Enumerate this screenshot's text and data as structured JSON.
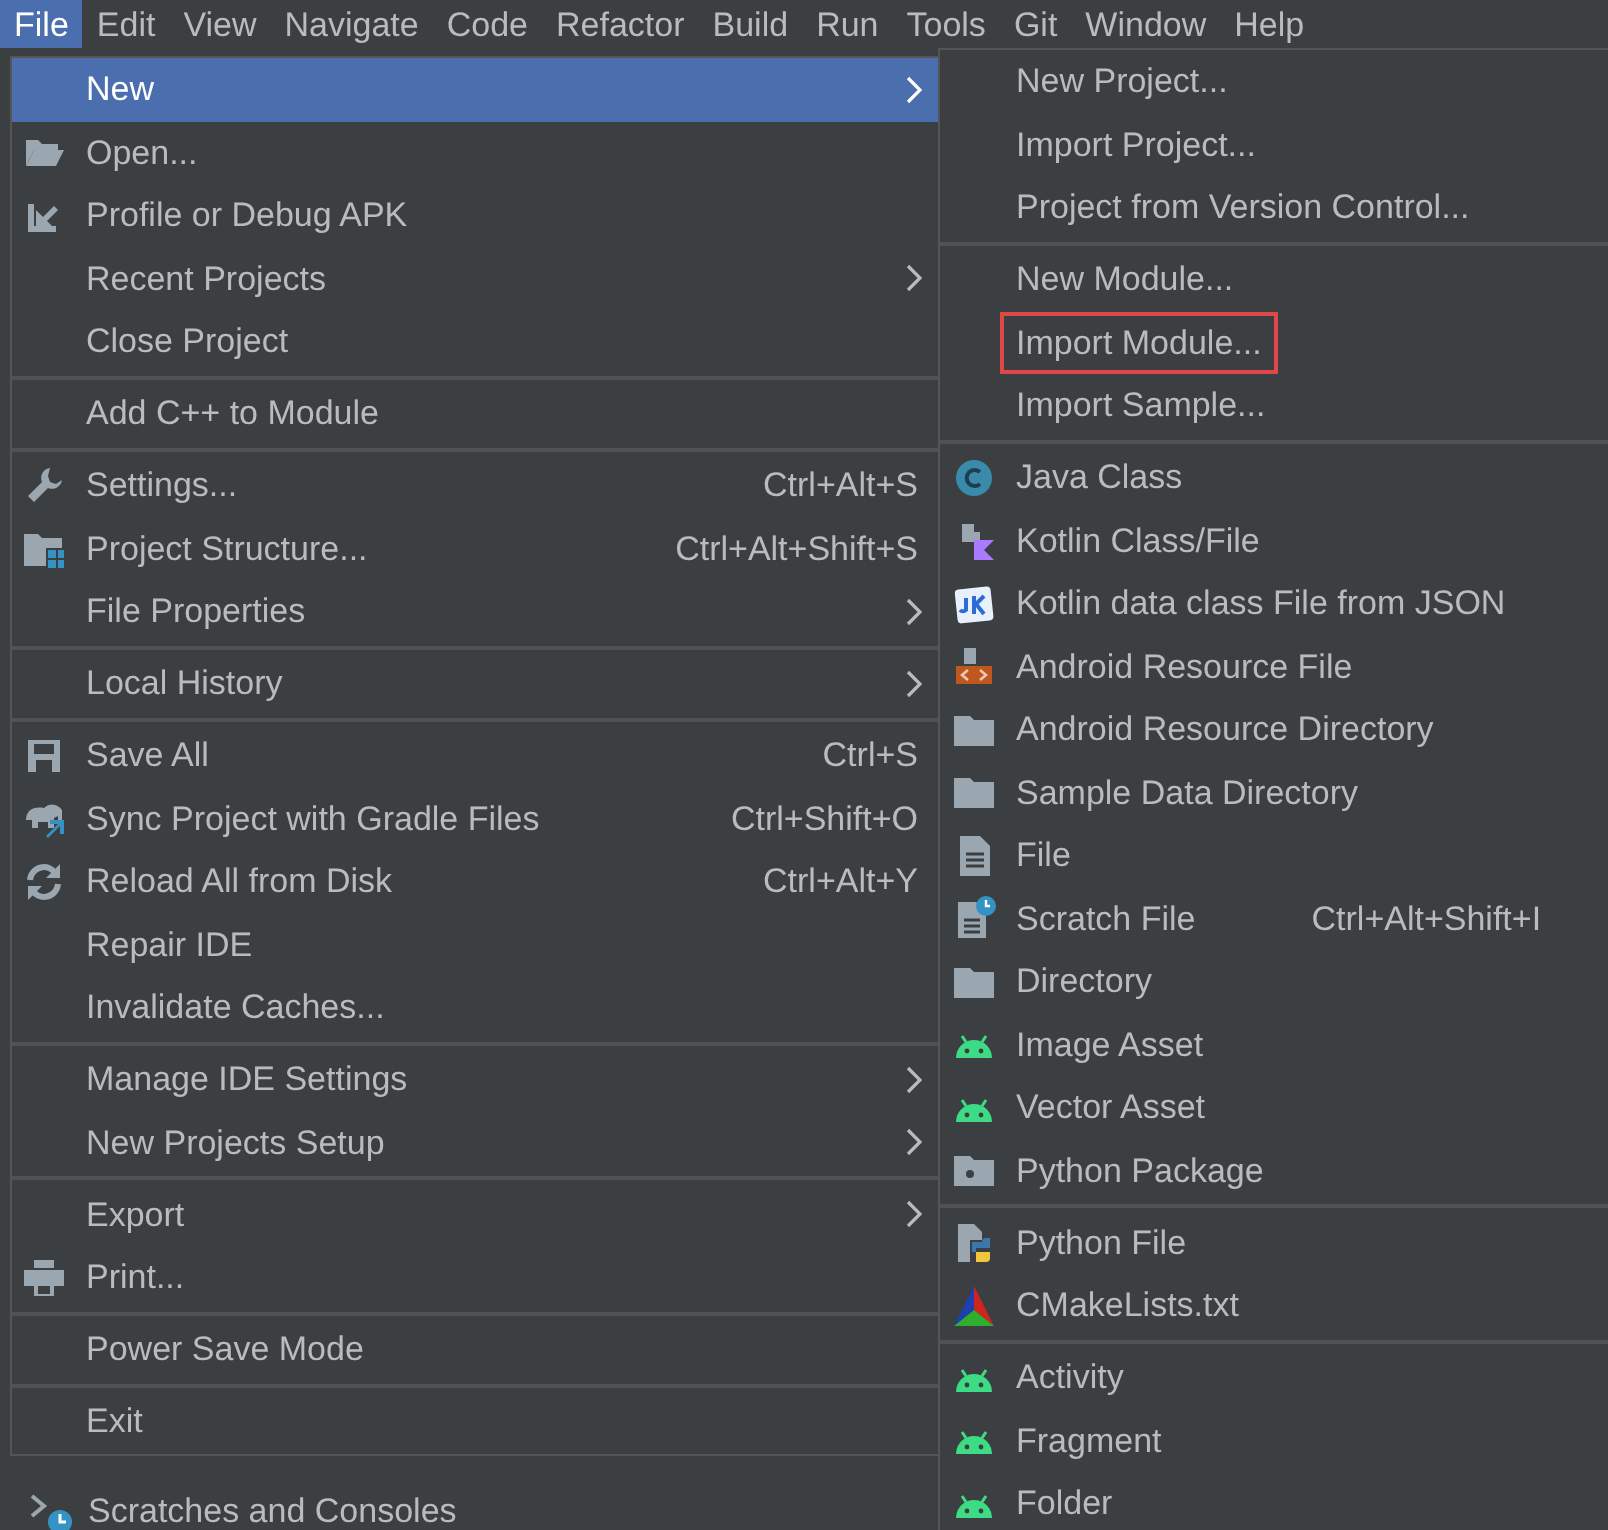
{
  "menu_bar": [
    {
      "label": "File",
      "selected": true
    },
    {
      "label": "Edit",
      "selected": false
    },
    {
      "label": "View",
      "selected": false
    },
    {
      "label": "Navigate",
      "selected": false
    },
    {
      "label": "Code",
      "selected": false
    },
    {
      "label": "Refactor",
      "selected": false
    },
    {
      "label": "Build",
      "selected": false
    },
    {
      "label": "Run",
      "selected": false
    },
    {
      "label": "Tools",
      "selected": false
    },
    {
      "label": "Git",
      "selected": false
    },
    {
      "label": "Window",
      "selected": false
    },
    {
      "label": "Help",
      "selected": false
    }
  ],
  "file_menu": [
    {
      "kind": "plain",
      "label": "New",
      "selected": true,
      "submenu": true
    },
    {
      "kind": "open",
      "label": "Open...",
      "selected": false,
      "submenu": false
    },
    {
      "kind": "apk",
      "label": "Profile or Debug APK",
      "selected": false,
      "submenu": false
    },
    {
      "kind": "plain",
      "label": "Recent Projects",
      "selected": false,
      "submenu": true
    },
    {
      "kind": "plain",
      "label": "Close Project",
      "selected": false,
      "submenu": false
    },
    {
      "kind": "separator"
    },
    {
      "kind": "plain",
      "label": "Add C++ to Module",
      "selected": false,
      "submenu": false
    },
    {
      "kind": "separator"
    },
    {
      "kind": "settings",
      "label": "Settings...",
      "shortcut": "Ctrl+Alt+S",
      "selected": false,
      "submenu": false
    },
    {
      "kind": "structure",
      "label": "Project Structure...",
      "shortcut": "Ctrl+Alt+Shift+S",
      "selected": false,
      "submenu": false
    },
    {
      "kind": "plain",
      "label": "File Properties",
      "selected": false,
      "submenu": true
    },
    {
      "kind": "separator"
    },
    {
      "kind": "plain",
      "label": "Local History",
      "selected": false,
      "submenu": true
    },
    {
      "kind": "separator"
    },
    {
      "kind": "save",
      "label": "Save All",
      "shortcut": "Ctrl+S",
      "selected": false,
      "submenu": false
    },
    {
      "kind": "sync",
      "label": "Sync Project with Gradle Files",
      "shortcut": "Ctrl+Shift+O",
      "selected": false,
      "submenu": false
    },
    {
      "kind": "reload",
      "label": "Reload All from Disk",
      "shortcut": "Ctrl+Alt+Y",
      "selected": false,
      "submenu": false
    },
    {
      "kind": "plain",
      "label": "Repair IDE",
      "selected": false,
      "submenu": false
    },
    {
      "kind": "plain",
      "label": "Invalidate Caches...",
      "selected": false,
      "submenu": false
    },
    {
      "kind": "separator"
    },
    {
      "kind": "plain",
      "label": "Manage IDE Settings",
      "selected": false,
      "submenu": true
    },
    {
      "kind": "plain",
      "label": "New Projects Setup",
      "selected": false,
      "submenu": true
    },
    {
      "kind": "separator"
    },
    {
      "kind": "plain",
      "label": "Export",
      "selected": false,
      "submenu": true
    },
    {
      "kind": "print",
      "label": "Print...",
      "selected": false,
      "submenu": false
    },
    {
      "kind": "separator"
    },
    {
      "kind": "plain",
      "label": "Power Save Mode",
      "selected": false,
      "submenu": false
    },
    {
      "kind": "separator"
    },
    {
      "kind": "plain",
      "label": "Exit",
      "selected": false,
      "submenu": false
    }
  ],
  "new_submenu": [
    {
      "kind": "plain",
      "label": "New Project...",
      "highlighted": false
    },
    {
      "kind": "plain",
      "label": "Import Project...",
      "highlighted": false
    },
    {
      "kind": "plain",
      "label": "Project from Version Control...",
      "highlighted": false
    },
    {
      "kind": "separator"
    },
    {
      "kind": "plain",
      "label": "New Module...",
      "highlighted": false
    },
    {
      "kind": "plain",
      "label": "Import Module...",
      "highlighted": true
    },
    {
      "kind": "plain",
      "label": "Import Sample...",
      "highlighted": false
    },
    {
      "kind": "separator"
    },
    {
      "kind": "java",
      "label": "Java Class",
      "highlighted": false
    },
    {
      "kind": "kotlin",
      "label": "Kotlin Class/File",
      "highlighted": false
    },
    {
      "kind": "json",
      "label": "Kotlin data class File from JSON",
      "highlighted": false
    },
    {
      "kind": "resource",
      "label": "Android Resource File",
      "highlighted": false
    },
    {
      "kind": "directory",
      "label": "Android Resource Directory",
      "highlighted": false
    },
    {
      "kind": "directory",
      "label": "Sample Data Directory",
      "highlighted": false
    },
    {
      "kind": "file",
      "label": "File",
      "highlighted": false
    },
    {
      "kind": "scratch",
      "label": "Scratch File",
      "shortcut": "Ctrl+Alt+Shift+I",
      "highlighted": false
    },
    {
      "kind": "directory",
      "label": "Directory",
      "highlighted": false
    },
    {
      "kind": "android",
      "label": "Image Asset",
      "highlighted": false
    },
    {
      "kind": "android",
      "label": "Vector Asset",
      "highlighted": false
    },
    {
      "kind": "package",
      "label": "Python Package",
      "highlighted": false
    },
    {
      "kind": "separator"
    },
    {
      "kind": "python",
      "label": "Python File",
      "highlighted": false
    },
    {
      "kind": "cmake",
      "label": "CMakeLists.txt",
      "highlighted": false
    },
    {
      "kind": "separator"
    },
    {
      "kind": "android",
      "label": "Activity",
      "highlighted": false
    },
    {
      "kind": "android",
      "label": "Fragment",
      "highlighted": false
    },
    {
      "kind": "android",
      "label": "Folder",
      "highlighted": false
    }
  ],
  "project_tree": [
    {
      "kind": "scratches",
      "label": "Scratches and Consoles"
    }
  ]
}
